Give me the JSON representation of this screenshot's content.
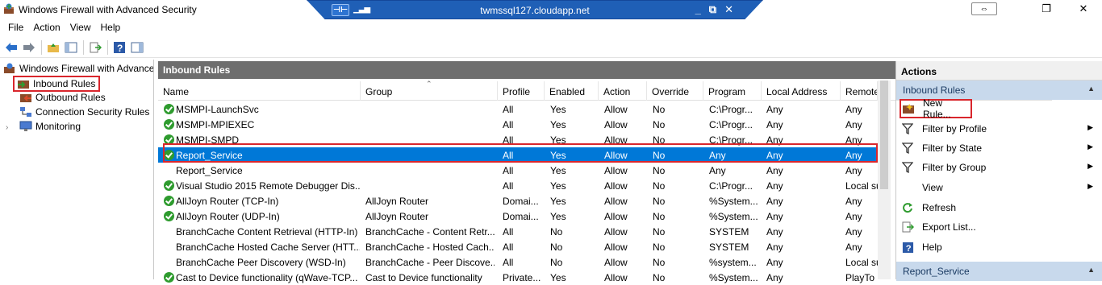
{
  "window": {
    "title": "Windows Firewall with Advanced Security",
    "rdp_host": "twmssql127.cloudapp.net",
    "icon": "firewall-icon"
  },
  "menu": [
    "File",
    "Action",
    "View",
    "Help"
  ],
  "tree": {
    "root": "Windows Firewall with Advanced Security on Local Computer",
    "items": [
      {
        "label": "Inbound Rules",
        "icon": "inbound-rules-icon"
      },
      {
        "label": "Outbound Rules",
        "icon": "outbound-rules-icon"
      },
      {
        "label": "Connection Security Rules",
        "icon": "connection-security-icon"
      },
      {
        "label": "Monitoring",
        "icon": "monitor-icon"
      }
    ]
  },
  "middle": {
    "title": "Inbound Rules",
    "columns": [
      "Name",
      "Group",
      "Profile",
      "Enabled",
      "Action",
      "Override",
      "Program",
      "Local Address",
      "Remote"
    ],
    "rows": [
      {
        "name": "MSMPI-LaunchSvc",
        "group": "",
        "profile": "All",
        "enabled": "Yes",
        "action": "Allow",
        "override": "No",
        "program": "C:\\Progr...",
        "local": "Any",
        "remote": "Any",
        "icon": true
      },
      {
        "name": "MSMPI-MPIEXEC",
        "group": "",
        "profile": "All",
        "enabled": "Yes",
        "action": "Allow",
        "override": "No",
        "program": "C:\\Progr...",
        "local": "Any",
        "remote": "Any",
        "icon": true
      },
      {
        "name": "MSMPI-SMPD",
        "group": "",
        "profile": "All",
        "enabled": "Yes",
        "action": "Allow",
        "override": "No",
        "program": "C:\\Progr...",
        "local": "Any",
        "remote": "Any",
        "icon": true
      },
      {
        "name": "Report_Service",
        "group": "",
        "profile": "All",
        "enabled": "Yes",
        "action": "Allow",
        "override": "No",
        "program": "Any",
        "local": "Any",
        "remote": "Any",
        "icon": true,
        "selected": true
      },
      {
        "name": "Report_Service",
        "group": "",
        "profile": "All",
        "enabled": "Yes",
        "action": "Allow",
        "override": "No",
        "program": "Any",
        "local": "Any",
        "remote": "Any",
        "icon": false
      },
      {
        "name": "Visual Studio 2015 Remote Debugger Dis...",
        "group": "",
        "profile": "All",
        "enabled": "Yes",
        "action": "Allow",
        "override": "No",
        "program": "C:\\Progr...",
        "local": "Any",
        "remote": "Local su",
        "icon": true
      },
      {
        "name": "AllJoyn Router (TCP-In)",
        "group": "AllJoyn Router",
        "profile": "Domai...",
        "enabled": "Yes",
        "action": "Allow",
        "override": "No",
        "program": "%System...",
        "local": "Any",
        "remote": "Any",
        "icon": true
      },
      {
        "name": "AllJoyn Router (UDP-In)",
        "group": "AllJoyn Router",
        "profile": "Domai...",
        "enabled": "Yes",
        "action": "Allow",
        "override": "No",
        "program": "%System...",
        "local": "Any",
        "remote": "Any",
        "icon": true
      },
      {
        "name": "BranchCache Content Retrieval (HTTP-In)",
        "group": "BranchCache - Content Retr...",
        "profile": "All",
        "enabled": "No",
        "action": "Allow",
        "override": "No",
        "program": "SYSTEM",
        "local": "Any",
        "remote": "Any",
        "icon": false
      },
      {
        "name": "BranchCache Hosted Cache Server (HTT...",
        "group": "BranchCache - Hosted Cach...",
        "profile": "All",
        "enabled": "No",
        "action": "Allow",
        "override": "No",
        "program": "SYSTEM",
        "local": "Any",
        "remote": "Any",
        "icon": false
      },
      {
        "name": "BranchCache Peer Discovery (WSD-In)",
        "group": "BranchCache - Peer Discove...",
        "profile": "All",
        "enabled": "No",
        "action": "Allow",
        "override": "No",
        "program": "%system...",
        "local": "Any",
        "remote": "Local su",
        "icon": false
      },
      {
        "name": "Cast to Device functionality (qWave-TCP...",
        "group": "Cast to Device functionality",
        "profile": "Private...",
        "enabled": "Yes",
        "action": "Allow",
        "override": "No",
        "program": "%System...",
        "local": "Any",
        "remote": "PlayTo l",
        "icon": true
      }
    ]
  },
  "actions": {
    "title": "Actions",
    "section1": "Inbound Rules",
    "items": [
      {
        "label": "New Rule...",
        "icon": "new-rule-icon",
        "submenu": false
      },
      {
        "label": "Filter by Profile",
        "icon": "filter-icon",
        "submenu": true
      },
      {
        "label": "Filter by State",
        "icon": "filter-icon",
        "submenu": true
      },
      {
        "label": "Filter by Group",
        "icon": "filter-icon",
        "submenu": true
      },
      {
        "label": "View",
        "icon": "",
        "submenu": true
      },
      {
        "label": "Refresh",
        "icon": "refresh-icon",
        "submenu": false
      },
      {
        "label": "Export List...",
        "icon": "export-icon",
        "submenu": false
      },
      {
        "label": "Help",
        "icon": "help-icon",
        "submenu": false
      }
    ],
    "section2": "Report_Service"
  },
  "colors": {
    "selection": "#0078d7",
    "highlight_box": "#d9262c",
    "pane_header": "#6e6e6e",
    "section_bg": "#c8d9ec",
    "rdp_bar": "#1f5fb6"
  }
}
